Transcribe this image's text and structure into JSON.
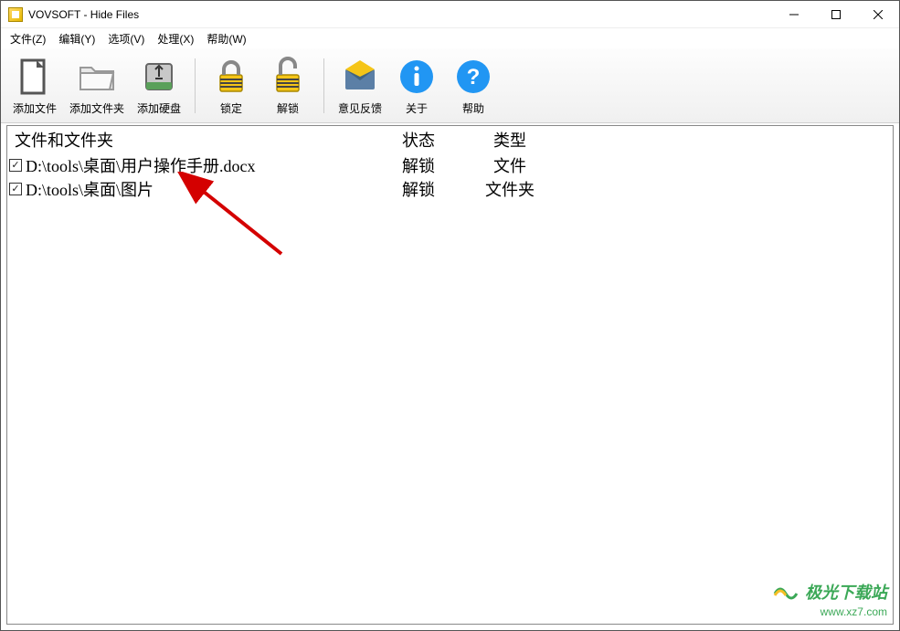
{
  "window": {
    "title": "VOVSOFT - Hide Files"
  },
  "menu": {
    "file": "文件(Z)",
    "edit": "编辑(Y)",
    "options": "选项(V)",
    "process": "处理(X)",
    "help": "帮助(W)"
  },
  "toolbar": {
    "add_file": "添加文件",
    "add_folder": "添加文件夹",
    "add_disk": "添加硬盘",
    "lock": "锁定",
    "unlock": "解锁",
    "feedback": "意见反馈",
    "about": "关于",
    "help": "帮助"
  },
  "columns": {
    "path": "文件和文件夹",
    "status": "状态",
    "type": "类型"
  },
  "rows": [
    {
      "checked": true,
      "path": "D:\\tools\\桌面\\用户操作手册.docx",
      "status": "解锁",
      "type": "文件"
    },
    {
      "checked": true,
      "path": "D:\\tools\\桌面\\图片",
      "status": "解锁",
      "type": "文件夹"
    }
  ],
  "watermark": {
    "line1": "极光下载站",
    "line2": "www.xz7.com"
  }
}
